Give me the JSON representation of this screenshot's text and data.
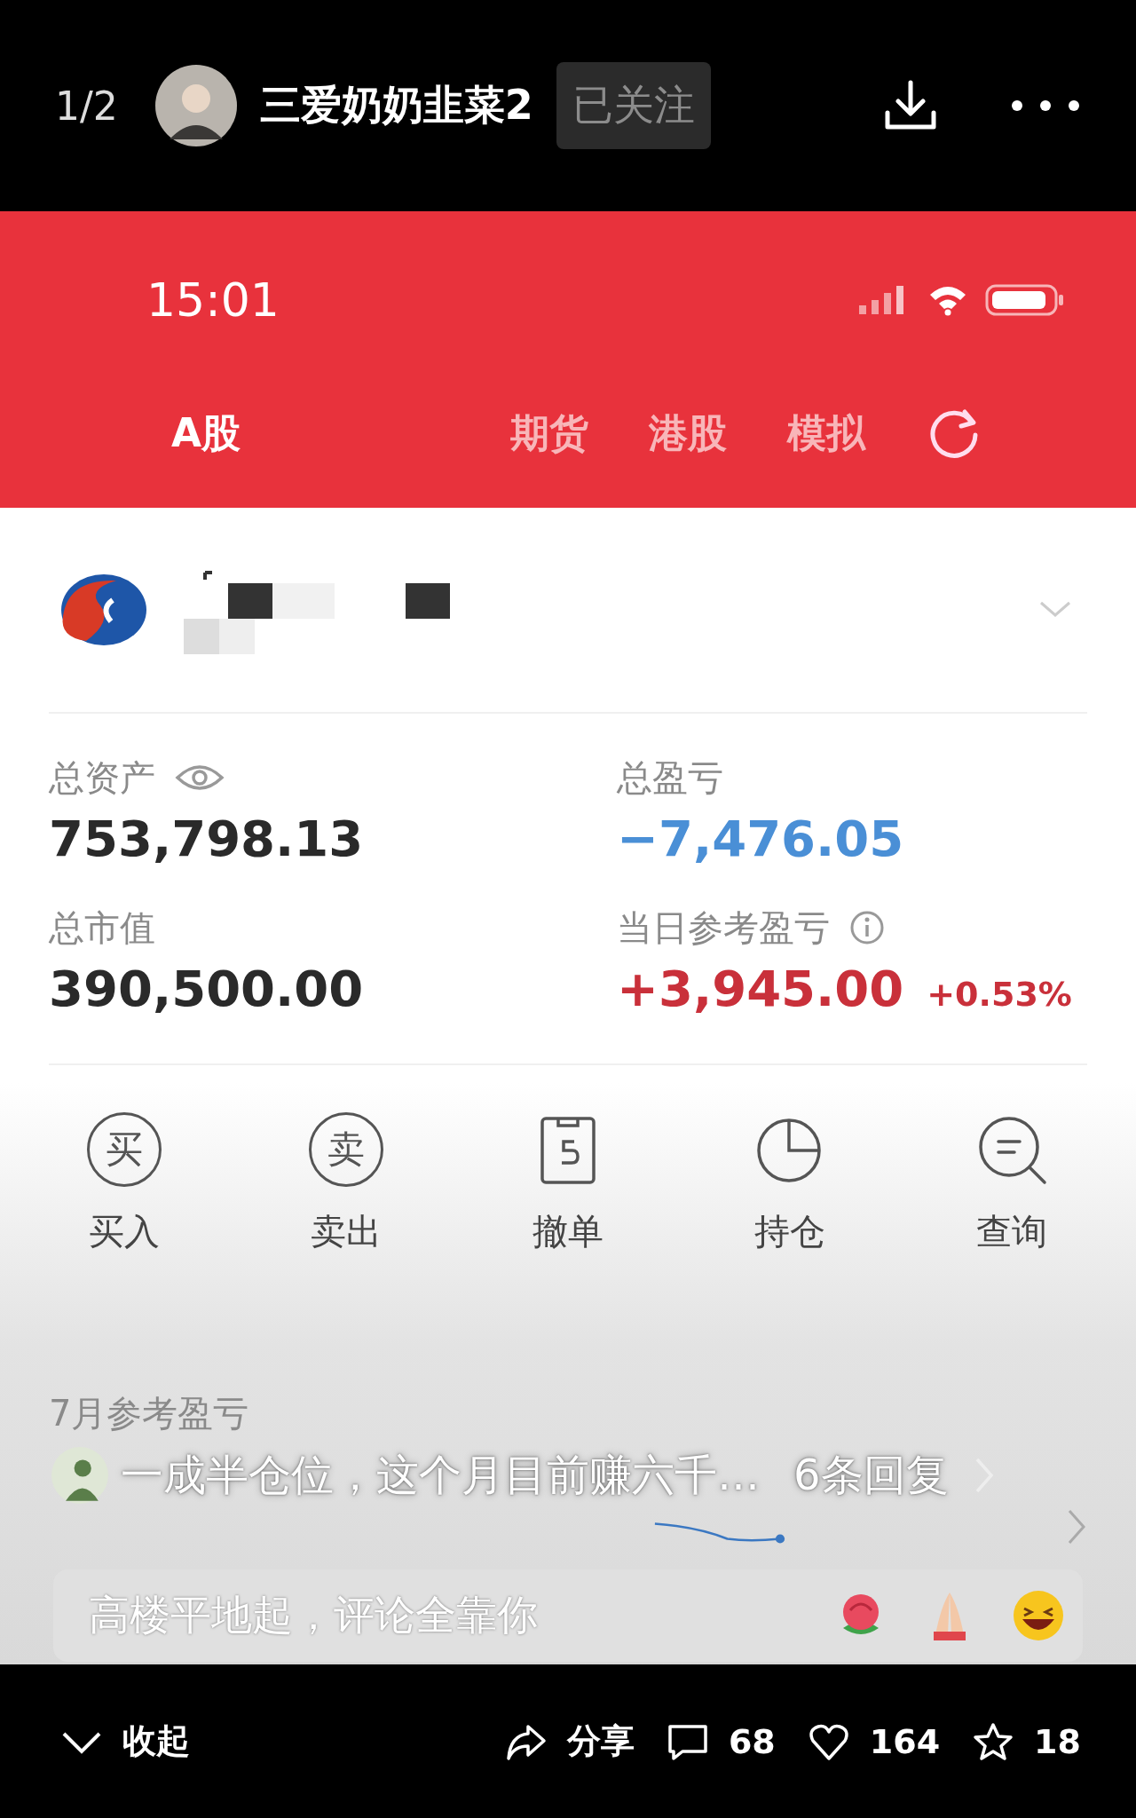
{
  "header": {
    "page_counter": "1/2",
    "author": "三爱奶奶韭菜2",
    "follow_label": "已关注",
    "followed": true
  },
  "post_image": {
    "status_bar": {
      "time": "15:01"
    },
    "tabs": [
      {
        "label": "A股",
        "selected": true
      },
      {
        "label": "期货",
        "selected": false
      },
      {
        "label": "港股",
        "selected": false
      },
      {
        "label": "模拟",
        "selected": false
      }
    ],
    "summary": [
      {
        "label": "总资产",
        "value": "753,798.13",
        "color": "#2a2a2a",
        "kind": "eye"
      },
      {
        "label": "总盈亏",
        "value": "−7,476.05",
        "color": "#4a8fd6",
        "kind": "plain"
      },
      {
        "label": "总市值",
        "value": "390,500.00",
        "color": "#2a2a2a",
        "kind": "plain"
      },
      {
        "label": "当日参考盈亏",
        "value": "+3,945.00",
        "change": "+0.53%",
        "color": "#c9303a",
        "kind": "info"
      }
    ],
    "actions": [
      {
        "kind": "glyph",
        "glyph": "买",
        "label": "买入"
      },
      {
        "kind": "glyph",
        "glyph": "卖",
        "label": "卖出"
      },
      {
        "kind": "cancel",
        "label": "撤单"
      },
      {
        "kind": "pie",
        "label": "持仓"
      },
      {
        "kind": "search",
        "label": "查询"
      }
    ],
    "monthly": {
      "label": "7月参考盈亏"
    }
  },
  "comment": {
    "text": "一成半仓位，这个月目前赚六千…",
    "replies": "6条回复"
  },
  "comment_prompt": {
    "text": "高楼平地起，评论全靠你"
  },
  "footer": {
    "collapse": "收起",
    "share": "分享",
    "comments": "68",
    "likes": "164",
    "favorites": "18"
  }
}
